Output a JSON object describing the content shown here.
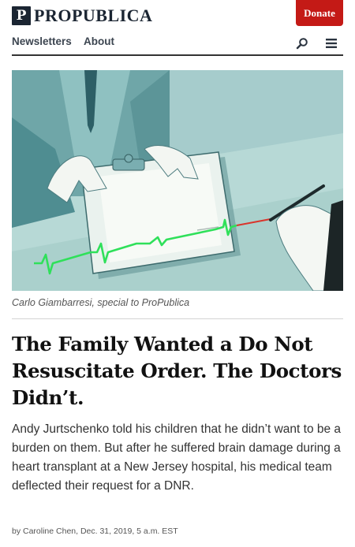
{
  "header": {
    "logo_mark": "P",
    "logo_text": "PROPUBLICA",
    "donate_label": "Donate",
    "colors": {
      "donate_bg": "#c41a16",
      "logo_dark": "#1b2532"
    }
  },
  "nav": {
    "items": [
      {
        "label": "Newsletters"
      },
      {
        "label": "About"
      }
    ],
    "icons": [
      "search-icon",
      "menu-icon"
    ]
  },
  "hero": {
    "caption": "Carlo Giambarresi, special to ProPublica",
    "colors": {
      "background": "#a6cccc",
      "line_green": "#2fe05a",
      "line_red": "#d9352c"
    }
  },
  "article": {
    "headline": "The Family Wanted a Do Not Resuscitate Order. The Doctors Didn’t.",
    "dek": "Andy Jurtschenko told his children that he didn’t want to be a burden on them. But after he suffered brain damage during a heart transplant at a New Jersey hospital, his medical team deflected their request for a DNR.",
    "byline": "by Caroline Chen, Dec. 31, 2019, 5 a.m. EST"
  }
}
